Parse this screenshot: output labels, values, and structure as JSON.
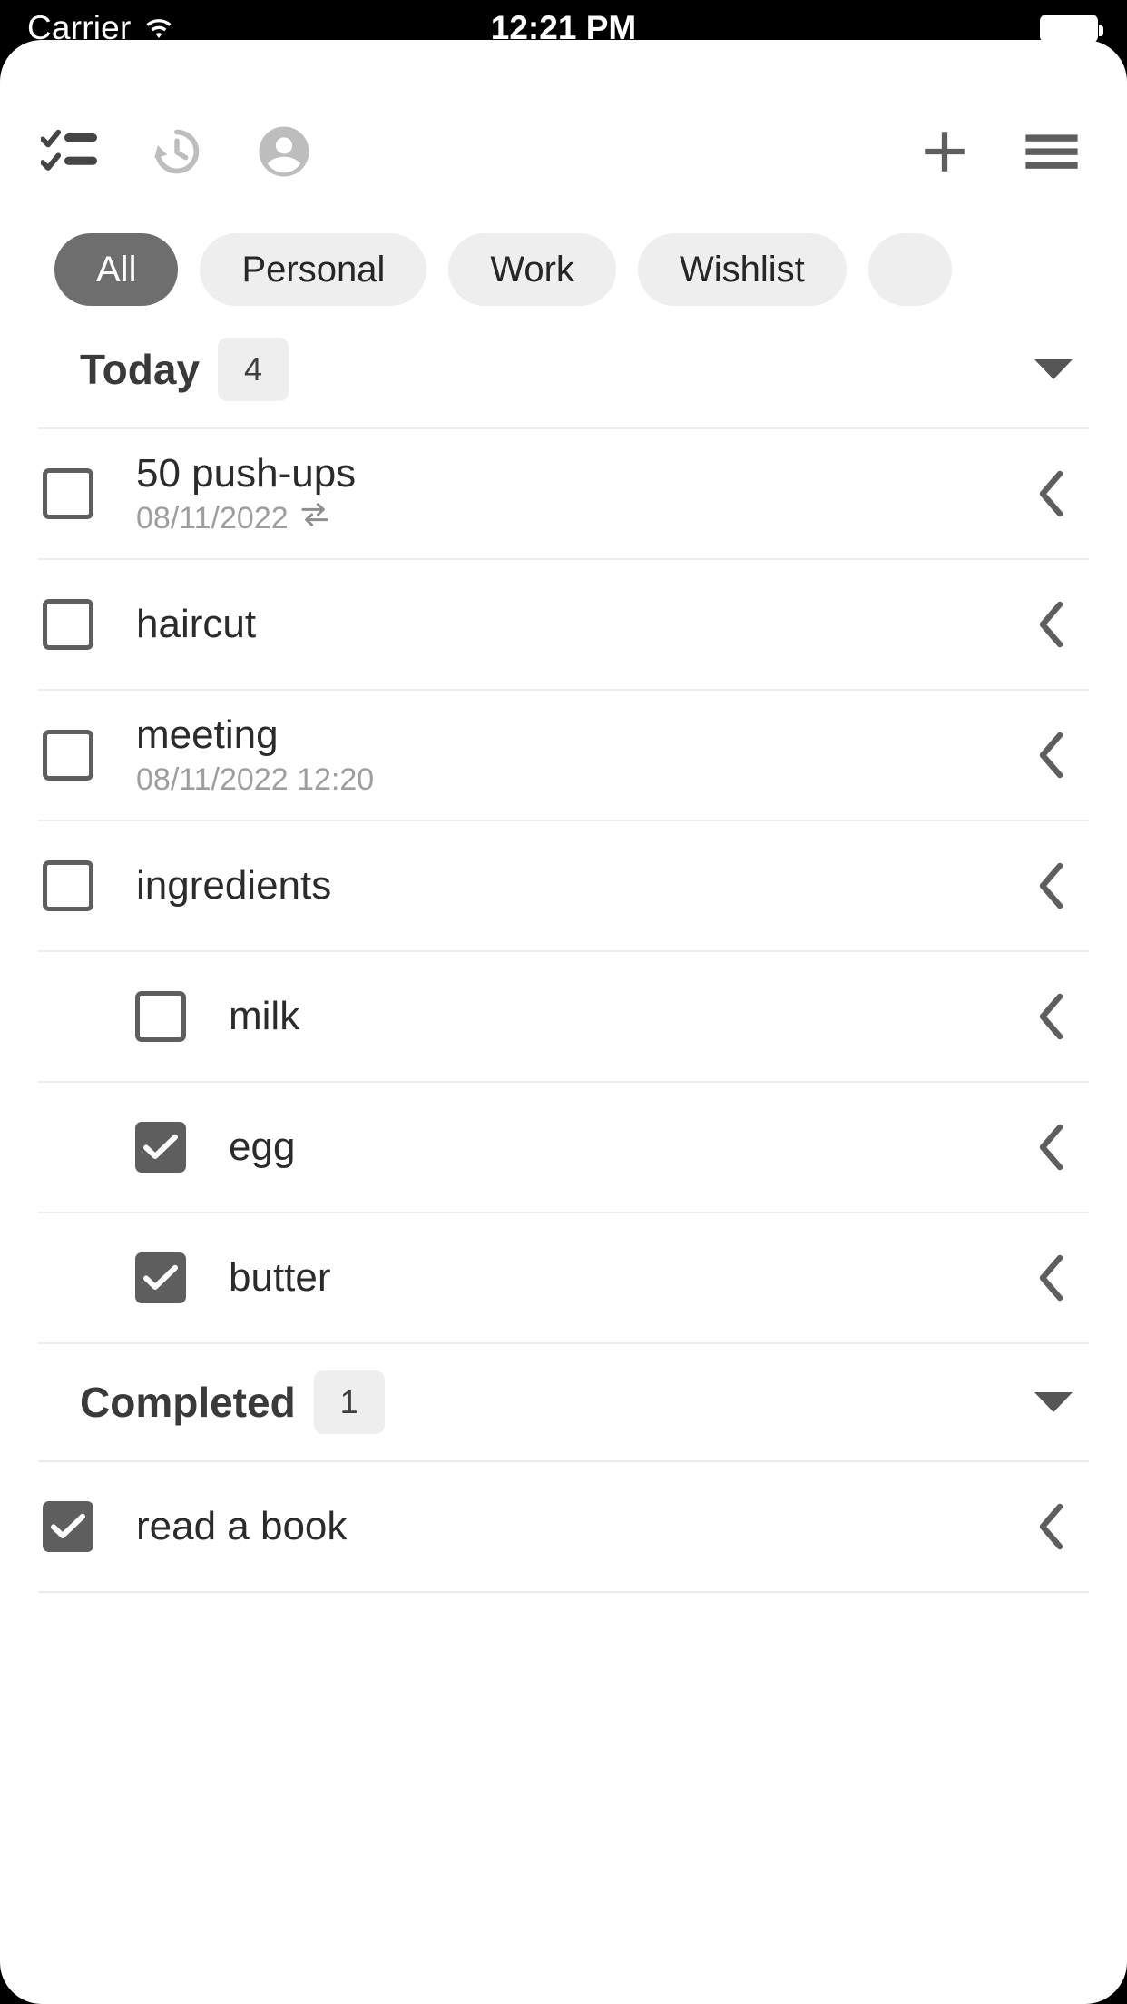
{
  "status_bar": {
    "carrier": "Carrier",
    "wifi_icon": "wifi-icon",
    "time": "12:21 PM",
    "battery_icon": "battery-full-icon"
  },
  "toolbar": {
    "left_items": [
      {
        "name": "checklist-icon",
        "state": "active"
      },
      {
        "name": "history-icon",
        "state": "inactive"
      },
      {
        "name": "account-circle-icon",
        "state": "inactive"
      }
    ],
    "right_items": [
      {
        "name": "plus-icon",
        "label": "Add"
      },
      {
        "name": "hamburger-menu-icon",
        "label": "Menu"
      }
    ]
  },
  "filters": {
    "chips": [
      {
        "label": "All",
        "active": true
      },
      {
        "label": "Personal",
        "active": false
      },
      {
        "label": "Work",
        "active": false
      },
      {
        "label": "Wishlist",
        "active": false
      },
      {
        "label": "",
        "active": false
      }
    ]
  },
  "sections": [
    {
      "title": "Today",
      "count": "4",
      "collapse_icon": "caret-down-icon",
      "tasks": [
        {
          "title": "50 push-ups",
          "meta": "08/11/2022",
          "repeat_icon": "repeat-icon",
          "checked": false,
          "indent": false,
          "chevron": "chevron-left-icon"
        },
        {
          "title": "haircut",
          "meta": "",
          "repeat_icon": "",
          "checked": false,
          "indent": false,
          "chevron": "chevron-left-icon"
        },
        {
          "title": "meeting",
          "meta": "08/11/2022 12:20",
          "repeat_icon": "",
          "checked": false,
          "indent": false,
          "chevron": "chevron-left-icon"
        },
        {
          "title": "ingredients",
          "meta": "",
          "repeat_icon": "",
          "checked": false,
          "indent": false,
          "chevron": "chevron-left-icon"
        },
        {
          "title": "milk",
          "meta": "",
          "repeat_icon": "",
          "checked": false,
          "indent": true,
          "chevron": "chevron-left-icon"
        },
        {
          "title": "egg",
          "meta": "",
          "repeat_icon": "",
          "checked": true,
          "indent": true,
          "chevron": "chevron-left-icon"
        },
        {
          "title": "butter",
          "meta": "",
          "repeat_icon": "",
          "checked": true,
          "indent": true,
          "chevron": "chevron-left-icon"
        }
      ]
    },
    {
      "title": "Completed",
      "count": "1",
      "collapse_icon": "caret-down-icon",
      "tasks": [
        {
          "title": "read a book",
          "meta": "",
          "repeat_icon": "",
          "checked": true,
          "indent": false,
          "chevron": "chevron-left-icon"
        }
      ]
    }
  ],
  "colors": {
    "accent": "#6e6e6e",
    "chip_bg": "#eeeeee",
    "text_primary": "#2b2b2b",
    "text_muted": "#9e9e9e",
    "divider": "#ececec",
    "status_bar_bg": "#000000"
  }
}
